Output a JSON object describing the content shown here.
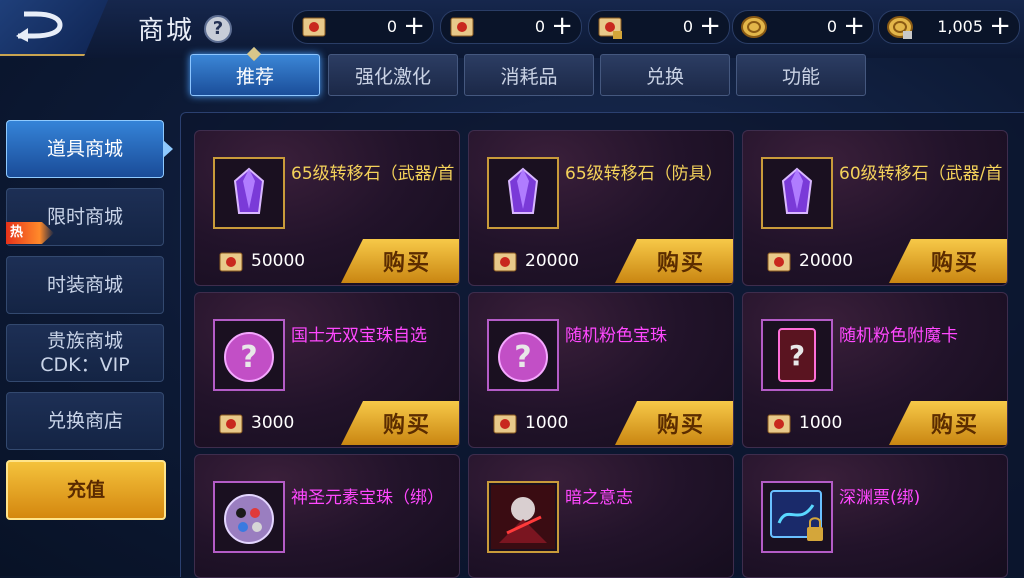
{
  "header": {
    "title": "商城",
    "help_symbol": "?",
    "currencies": [
      {
        "icon": "red-scroll-icon",
        "value": "0"
      },
      {
        "icon": "red-scroll-icon",
        "value": "0"
      },
      {
        "icon": "locked-red-scroll-icon",
        "value": "0"
      },
      {
        "icon": "gold-coin-icon",
        "value": "0"
      },
      {
        "icon": "locked-gold-coin-icon",
        "value": "1,005"
      }
    ],
    "plus_symbol": "+"
  },
  "tabs": [
    {
      "label": "推荐",
      "active": true
    },
    {
      "label": "强化激化",
      "active": false
    },
    {
      "label": "消耗品",
      "active": false
    },
    {
      "label": "兑换",
      "active": false
    },
    {
      "label": "功能",
      "active": false
    }
  ],
  "sidebar": {
    "items": [
      {
        "label": "道具商城",
        "active": true
      },
      {
        "label": "限时商城",
        "hot": "热"
      },
      {
        "label": "时装商城"
      },
      {
        "label": "贵族商城",
        "sub": "CDK：VIP"
      },
      {
        "label": "兑换商店"
      },
      {
        "label": "充值",
        "recharge": true
      }
    ]
  },
  "products": [
    {
      "name": "65级转移石（武器/首",
      "price": "50000",
      "buy": "购买",
      "icon": "purple-crystal-icon",
      "name_color": "gold"
    },
    {
      "name": "65级转移石（防具）",
      "price": "20000",
      "buy": "购买",
      "icon": "purple-crystal-icon",
      "name_color": "gold"
    },
    {
      "name": "60级转移石（武器/首",
      "price": "20000",
      "buy": "购买",
      "icon": "purple-crystal-icon",
      "name_color": "gold"
    },
    {
      "name": "国士无双宝珠自选",
      "price": "3000",
      "buy": "购买",
      "icon": "mystery-orb-icon",
      "name_color": "pink"
    },
    {
      "name": "随机粉色宝珠",
      "price": "1000",
      "buy": "购买",
      "icon": "mystery-orb-icon",
      "name_color": "pink"
    },
    {
      "name": "随机粉色附魔卡",
      "price": "1000",
      "buy": "购买",
      "icon": "mystery-card-icon",
      "name_color": "pink"
    },
    {
      "name": "神圣元素宝珠（绑）",
      "price": "",
      "buy": "",
      "icon": "element-orb-icon",
      "name_color": "pink"
    },
    {
      "name": "暗之意志",
      "price": "",
      "buy": "",
      "icon": "dark-will-icon",
      "name_color": "pink"
    },
    {
      "name": "深渊票(绑)",
      "price": "",
      "buy": "",
      "icon": "abyss-ticket-icon",
      "name_color": "pink"
    }
  ]
}
